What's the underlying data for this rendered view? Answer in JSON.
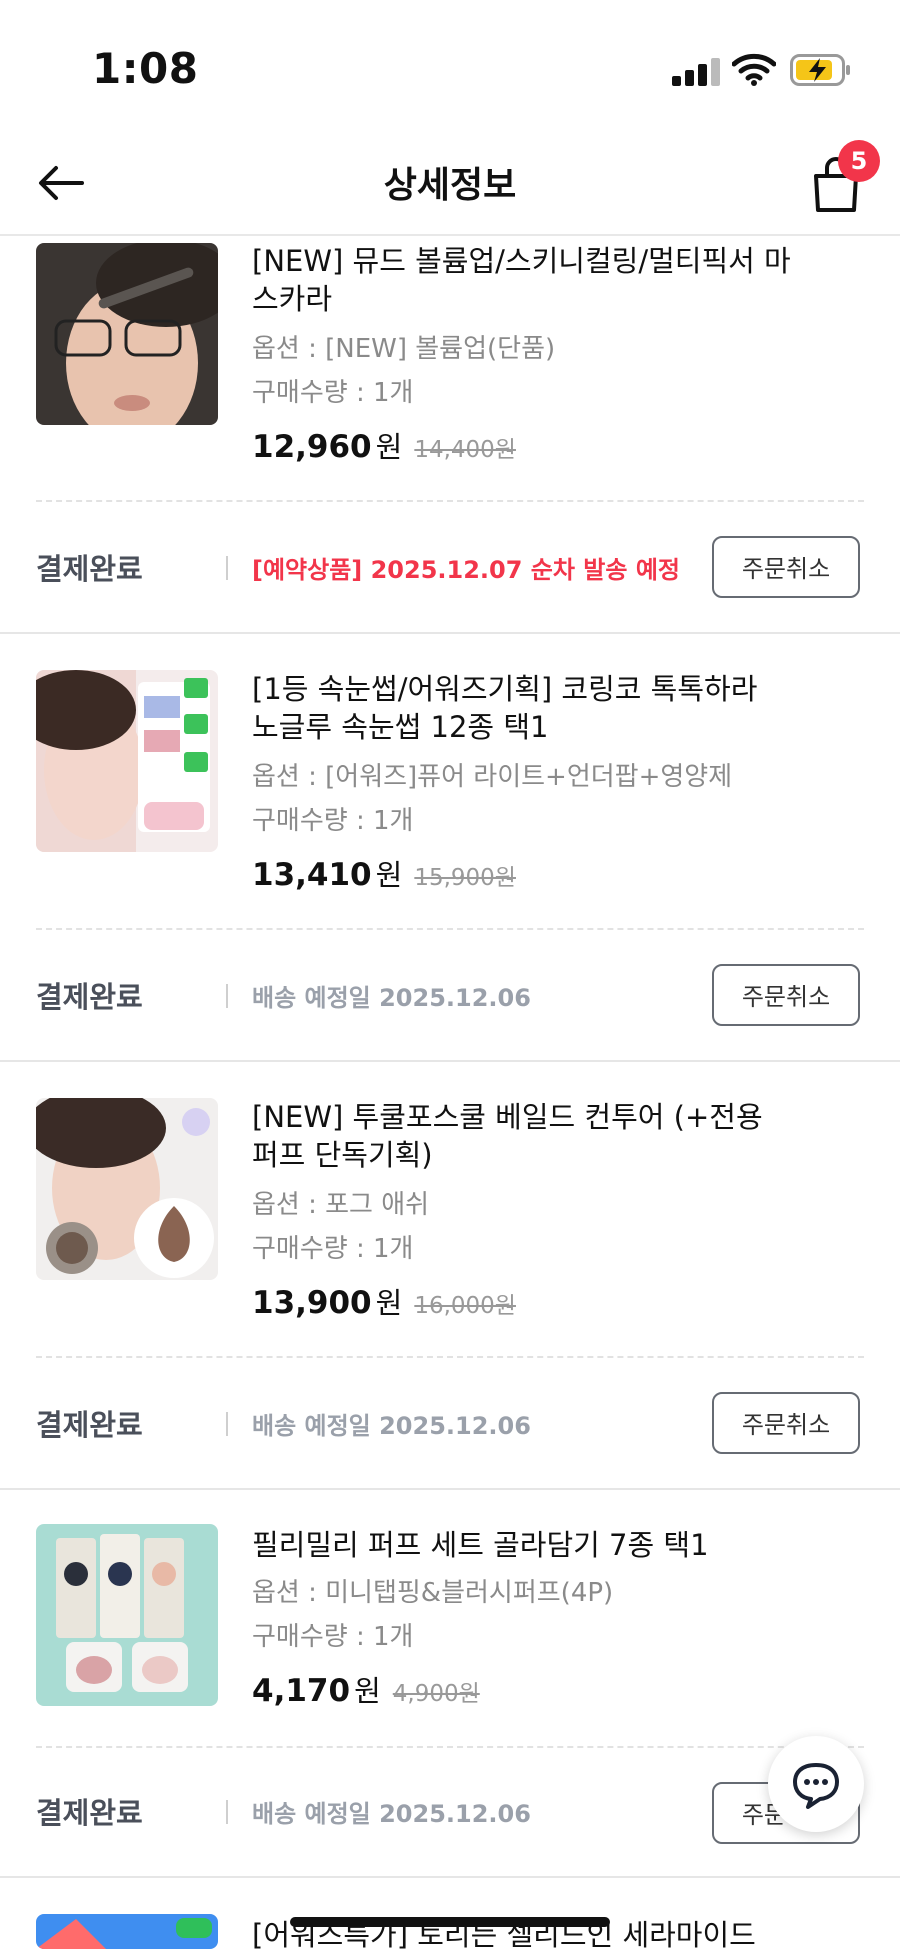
{
  "status_bar": {
    "time": "1:08"
  },
  "header": {
    "title": "상세정보",
    "cart_count": "5"
  },
  "items": [
    {
      "name": "[NEW] 뮤드 볼륨업/스키니컬링/멀티픽서 마스카라",
      "option": "옵션 : [NEW] 볼륨업(단품)",
      "quantity": "구매수량 : 1개",
      "price": "12,960",
      "won": "원",
      "original_price": "14,400원",
      "status": "결제완료",
      "shipping": "[예약상품] 2025.12.07 순차 발송 예정",
      "cancel_label": "주문취소"
    },
    {
      "name": "[1등 속눈썹/어워즈기획] 코링코 톡톡하라 노글루 속눈썹 12종 택1",
      "option": "옵션 : [어워즈]퓨어 라이트+언더팝+영양제",
      "quantity": "구매수량 : 1개",
      "price": "13,410",
      "won": "원",
      "original_price": "15,900원",
      "status": "결제완료",
      "shipping": "배송 예정일 2025.12.06",
      "cancel_label": "주문취소"
    },
    {
      "name": "[NEW] 투쿨포스쿨 베일드 컨투어 (+전용 퍼프 단독기획)",
      "option": "옵션 : 포그 애쉬",
      "quantity": "구매수량 : 1개",
      "price": "13,900",
      "won": "원",
      "original_price": "16,000원",
      "status": "결제완료",
      "shipping": "배송 예정일 2025.12.06",
      "cancel_label": "주문취소"
    },
    {
      "name": "필리밀리 퍼프 세트 골라담기 7종 택1",
      "option": "옵션 : 미니탭핑&블러시퍼프(4P)",
      "quantity": "구매수량 : 1개",
      "price": "4,170",
      "won": "원",
      "original_price": "4,900원",
      "status": "결제완료",
      "shipping": "배송 예정일 2025.12.06",
      "cancel_label": "주문취소"
    },
    {
      "name": "[어워즈특가] 토리든 셀리드인 세라마이드"
    }
  ],
  "colors": {
    "accent": "#f2354a",
    "muted": "#9aa0aa"
  }
}
